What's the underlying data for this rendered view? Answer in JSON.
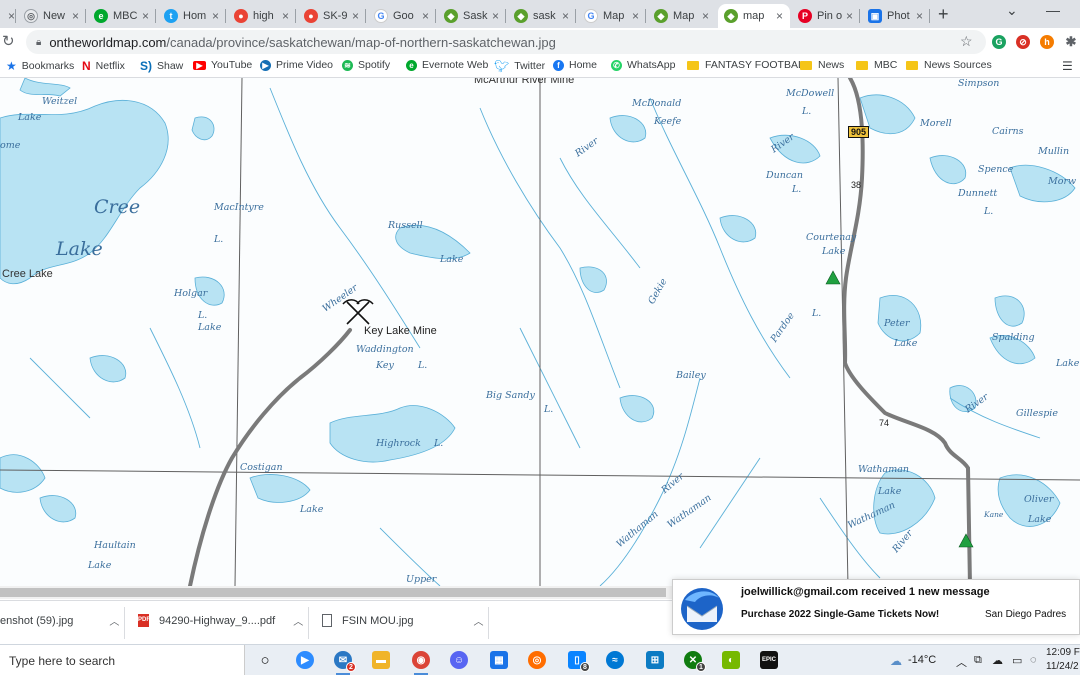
{
  "browser": {
    "tabs": [
      {
        "label": "",
        "icon": "unknown-icon",
        "color": "#5f6368"
      },
      {
        "label": "New",
        "icon": "globe-icon",
        "color": "#5f6368"
      },
      {
        "label": "MBC",
        "icon": "evernote-icon",
        "color": "#00a82d"
      },
      {
        "label": "Hom",
        "icon": "twitter-icon",
        "color": "#1da1f2"
      },
      {
        "label": "high",
        "icon": "maps-pin-icon",
        "color": "#ea4335"
      },
      {
        "label": "SK-9",
        "icon": "maps-pin-icon",
        "color": "#ea4335"
      },
      {
        "label": "Goo",
        "icon": "google-icon",
        "color": "#4285f4"
      },
      {
        "label": "Sask",
        "icon": "map-site-icon",
        "color": "#5aa02c"
      },
      {
        "label": "sask",
        "icon": "map-site-icon",
        "color": "#5aa02c"
      },
      {
        "label": "Map",
        "icon": "google-icon",
        "color": "#4285f4"
      },
      {
        "label": "Map",
        "icon": "map-site-icon",
        "color": "#5aa02c"
      },
      {
        "label": "map",
        "icon": "map-site-icon",
        "color": "#5aa02c",
        "active": true
      },
      {
        "label": "Pin o",
        "icon": "pinterest-icon",
        "color": "#e60023"
      },
      {
        "label": "Phot",
        "icon": "photo-icon",
        "color": "#1a73e8"
      }
    ],
    "new_tab_symbol": "+",
    "close_symbol": "×",
    "url_domain": "ontheworldmap.com",
    "url_path": "/canada/province/saskatchewan/map-of-northern-saskatchewan.jpg",
    "bookmarks": [
      {
        "label": "Bookmarks",
        "icon": "star-icon",
        "color": "#1a73e8"
      },
      {
        "label": "Netflix",
        "icon": "netflix-icon",
        "color": "#e50914"
      },
      {
        "label": "Shaw",
        "icon": "shaw-icon",
        "color": "#0a6fb8"
      },
      {
        "label": "YouTube",
        "icon": "youtube-icon",
        "color": "#ff0000"
      },
      {
        "label": "Prime Video",
        "icon": "prime-video-icon",
        "color": "#146eb4"
      },
      {
        "label": "Spotify",
        "icon": "spotify-icon",
        "color": "#1db954"
      },
      {
        "label": "Evernote Web",
        "icon": "evernote-icon",
        "color": "#00a82d"
      },
      {
        "label": "Twitter",
        "icon": "twitter-icon",
        "color": "#1da1f2"
      },
      {
        "label": "Home",
        "icon": "facebook-icon",
        "color": "#1877f2"
      },
      {
        "label": "WhatsApp",
        "icon": "whatsapp-icon",
        "color": "#25d366"
      },
      {
        "label": "FANTASY FOOTBALL",
        "icon": "folder-icon",
        "color": "#f5c518"
      },
      {
        "label": "News",
        "icon": "folder-icon",
        "color": "#f5c518"
      },
      {
        "label": "MBC",
        "icon": "folder-icon",
        "color": "#f5c518"
      },
      {
        "label": "News Sources",
        "icon": "folder-icon",
        "color": "#f5c518"
      }
    ]
  },
  "map": {
    "water_color": "#b8e3f3",
    "shore_color": "#5ab0d8",
    "labels": {
      "mcarthur": "McArthur River Mine",
      "weitzel": "Weitzel",
      "lake1": "Lake",
      "ome": "ome",
      "cree": "Cree",
      "lake_big": "Lake",
      "cree_lake": "Cree Lake",
      "macintyre": "MacIntyre",
      "l1": "L.",
      "russell": "Russell",
      "lake2": "Lake",
      "holgar": "Holgar",
      "l2": "L.",
      "lake3": "Lake",
      "wheeler": "Wheeler",
      "key_lake_mine": "Key Lake Mine",
      "waddington": "Waddington",
      "key": "Key",
      "l3": "L.",
      "big_sandy": "Big Sandy",
      "l4": "L.",
      "highrock": "Highrock",
      "l5": "L.",
      "costigan": "Costigan",
      "lake4": "Lake",
      "haultain": "Haultain",
      "lake5": "Lake",
      "upper": "Upper",
      "mcdonald": "McDonald",
      "keefe": "Keefe",
      "river1": "River",
      "gekie": "Gekie",
      "bailey": "Bailey",
      "duncan": "Duncan",
      "l6": "L.",
      "river2": "River",
      "courtenay": "Courtenay",
      "lake6": "Lake",
      "pardoe": "Pardoe",
      "l7": "L.",
      "mcdowell": "McDowell",
      "l8": "L.",
      "wathaman1": "Wathaman",
      "river3": "River",
      "wathaman_bottom": "Wathaman",
      "simpson": "Simpson",
      "morell": "Morell",
      "cairns": "Cairns",
      "mullin": "Mullin",
      "spence": "Spence",
      "dunnett": "Dunnett",
      "morw": "Morw",
      "l9": "L.",
      "peter": "Peter",
      "lake7": "Lake",
      "spalding": "Spalding",
      "lake8": "Lake",
      "river4": "River",
      "gillespie": "Gillespie",
      "wathaman2": "Wathaman",
      "lake9": "Lake",
      "wathaman3": "Wathaman",
      "river5": "River",
      "oliver": "Oliver",
      "lake10": "Lake",
      "kane": "Kane",
      "hwy_905": "905",
      "km_38": "38",
      "km_74": "74"
    }
  },
  "downloads": [
    {
      "label": "enshot (59).jpg",
      "icon": "image-file-icon"
    },
    {
      "label": "94290-Highway_9....pdf",
      "icon": "pdf-file-icon"
    },
    {
      "label": "FSIN MOU.jpg",
      "icon": "image-file-icon"
    }
  ],
  "notification": {
    "title": "joelwillick@gmail.com received 1 new message",
    "subject": "Purchase 2022 Single-Game Tickets Now!",
    "sender": "San Diego Padres"
  },
  "taskbar": {
    "search_placeholder": "Type here to search",
    "temperature": "-14°C",
    "time": "12:09 F",
    "date": "11/24/2",
    "zoom_badge": "2",
    "phone_badge": "8",
    "xbox_badge": "1"
  }
}
